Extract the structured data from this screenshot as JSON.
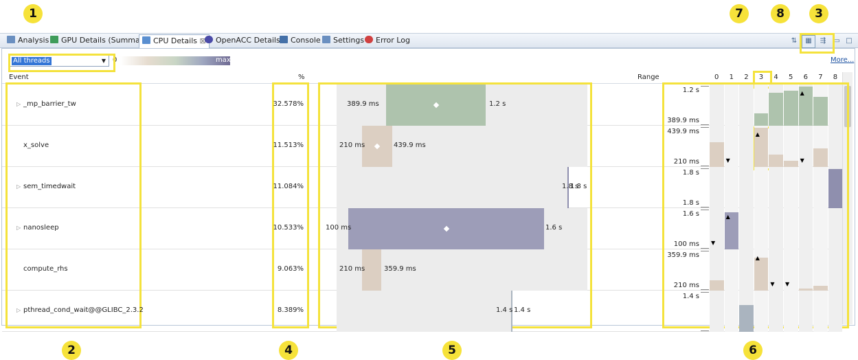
{
  "tabs": [
    {
      "label": "Analysis",
      "color": "#6a8fc0"
    },
    {
      "label": "GPU Details (Summary)",
      "color": "#3f9c5a"
    },
    {
      "label": "CPU Details",
      "close": "⊠",
      "color": "#5a8fd0",
      "active": true
    },
    {
      "label": "OpenACC Details",
      "color": "#4b4ba8"
    },
    {
      "label": "Console",
      "color": "#4470a8"
    },
    {
      "label": "Settings",
      "color": "#6a8fc0"
    },
    {
      "label": "Error Log",
      "color": "#d04040"
    }
  ],
  "toolbar": {
    "icons": [
      "sort-icon",
      "split-view-icon",
      "tree-view-icon",
      "minimize-icon",
      "maximize-icon"
    ]
  },
  "thread_select": {
    "value": "All threads"
  },
  "legend": {
    "min": "0",
    "max": "max"
  },
  "more_link": "More...",
  "headers": {
    "event": "Event",
    "percent": "%",
    "range": "Range",
    "threads": [
      "0",
      "1",
      "2",
      "3",
      "4",
      "5",
      "6",
      "7",
      "8"
    ]
  },
  "rows": [
    {
      "event": "_mp_barrier_tw",
      "expandable": true,
      "percent": "32.578%",
      "min_label": "389.9 ms",
      "max_label": "1.2 s",
      "color": "#aec3ad",
      "y_top": "1.2 s",
      "y_bottom": "389.9 ms"
    },
    {
      "event": "x_solve",
      "expandable": false,
      "percent": "11.513%",
      "min_label": "210 ms",
      "max_label": "439.9 ms",
      "color": "#dccfc2",
      "y_top": "439.9 ms",
      "y_bottom": "210 ms"
    },
    {
      "event": "sem_timedwait",
      "expandable": true,
      "percent": "11.084%",
      "min_label": "1.8 s",
      "max_label": "1.8 s",
      "color": "#8f8fae",
      "y_top": "1.8 s",
      "y_bottom": "1.8 s"
    },
    {
      "event": "nanosleep",
      "expandable": true,
      "percent": "10.533%",
      "min_label": "100 ms",
      "max_label": "1.6 s",
      "color": "#9d9db8",
      "y_top": "1.6 s",
      "y_bottom": "100 ms"
    },
    {
      "event": "compute_rhs",
      "expandable": false,
      "percent": "9.063%",
      "min_label": "210 ms",
      "max_label": "359.9 ms",
      "color": "#dccfc2",
      "y_top": "359.9 ms",
      "y_bottom": "210 ms"
    },
    {
      "event": "pthread_cond_wait@@GLIBC_2.3.2",
      "expandable": true,
      "percent": "8.389%",
      "min_label": "1.4 s",
      "max_label": "1.4 s",
      "color": "#aab4bf",
      "y_top": "1.4 s",
      "y_bottom": ""
    }
  ],
  "annotations": [
    "1",
    "2",
    "3",
    "4",
    "5",
    "6",
    "7",
    "8"
  ]
}
